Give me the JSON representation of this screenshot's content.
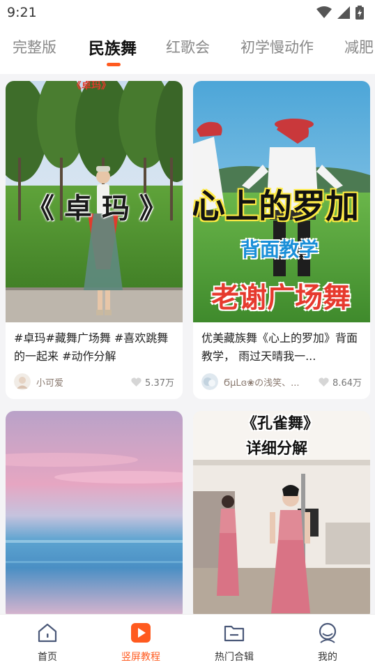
{
  "status_bar": {
    "time": "9:21"
  },
  "tabs": [
    {
      "label": "完整版"
    },
    {
      "label": "民族舞"
    },
    {
      "label": "红歌会"
    },
    {
      "label": "初学慢动作"
    },
    {
      "label": "减肥"
    }
  ],
  "active_tab": 1,
  "cards": [
    {
      "overlay_top": "《卓玛》",
      "overlay_main": "《 卓 玛 》",
      "title": "#卓玛#藏舞广场舞 #喜欢跳舞的一起来 #动作分解",
      "author": "小可爱",
      "likes": "5.37万"
    },
    {
      "overlay_main": "心上的罗加",
      "overlay_sub": "背面教学",
      "overlay_bottom": "老谢广场舞",
      "title": "优美藏族舞《心上的罗加》背面教学， 雨过天晴我一...",
      "author": "ϬμLɞ❀の浅笑、...",
      "likes": "8.64万"
    },
    {},
    {
      "overlay_main": "《孔雀舞》",
      "overlay_sub": "详细分解"
    }
  ],
  "bottom_nav": [
    {
      "label": "首页",
      "icon": "home-icon"
    },
    {
      "label": "竖屏教程",
      "icon": "play-icon"
    },
    {
      "label": "热门合辑",
      "icon": "folder-icon"
    },
    {
      "label": "我的",
      "icon": "profile-icon"
    }
  ],
  "colors": {
    "accent": "#ff5a1f"
  }
}
